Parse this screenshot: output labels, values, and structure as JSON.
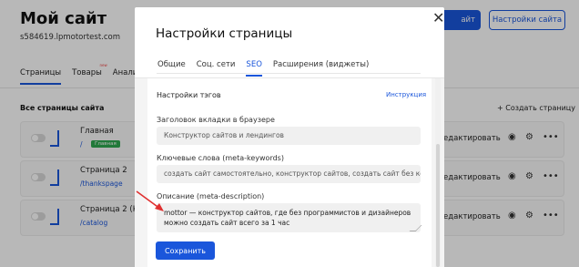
{
  "site": {
    "title": "Мой сайт",
    "domain": "s584619.lpmotortest.com",
    "publish_label": "айт",
    "settings_label": "Настройки сайта"
  },
  "page_tabs": [
    {
      "label": "Страницы",
      "active": true
    },
    {
      "label": "Товары",
      "badge": "new"
    },
    {
      "label": "Аналит"
    }
  ],
  "pages_list": {
    "title": "Все страницы сайта",
    "create_label": "+ Создать страницу",
    "rows": [
      {
        "name": "Главная",
        "path": "/",
        "badge": "Главная",
        "edit": "едактировать"
      },
      {
        "name": "Страница 2",
        "path": "/thankspage",
        "edit": "едактировать"
      },
      {
        "name": "Страница 2 (Ко",
        "path": "/catalog",
        "edit": "едактировать"
      }
    ]
  },
  "modal": {
    "title": "Настройки страницы",
    "tabs": [
      {
        "label": "Общие"
      },
      {
        "label": "Соц. сети"
      },
      {
        "label": "SEO",
        "active": true
      },
      {
        "label": "Расширения (виджеты)"
      }
    ],
    "section_title": "Настройки тэгов",
    "instruction_link": "Инструкция",
    "fields": {
      "title_label": "Заголовок вкладки в браузере",
      "title_placeholder": "Конструктор сайтов и лендингов",
      "keywords_label": "Ключевые слова (meta-keywords)",
      "keywords_placeholder": "создать сайт самостоятельно, конструктор сайтов, создать сайт без кода",
      "description_label": "Описание (meta-description)",
      "description_line1": "mottor — конструктор сайтов, где без программистов и дизайнеров",
      "description_line2": "можно создать сайт всего за 1 час"
    },
    "save_label": "Сохранить"
  },
  "colors": {
    "accent": "#1a56db",
    "badge_green": "#2fa84f",
    "arrow_red": "#e03030"
  }
}
